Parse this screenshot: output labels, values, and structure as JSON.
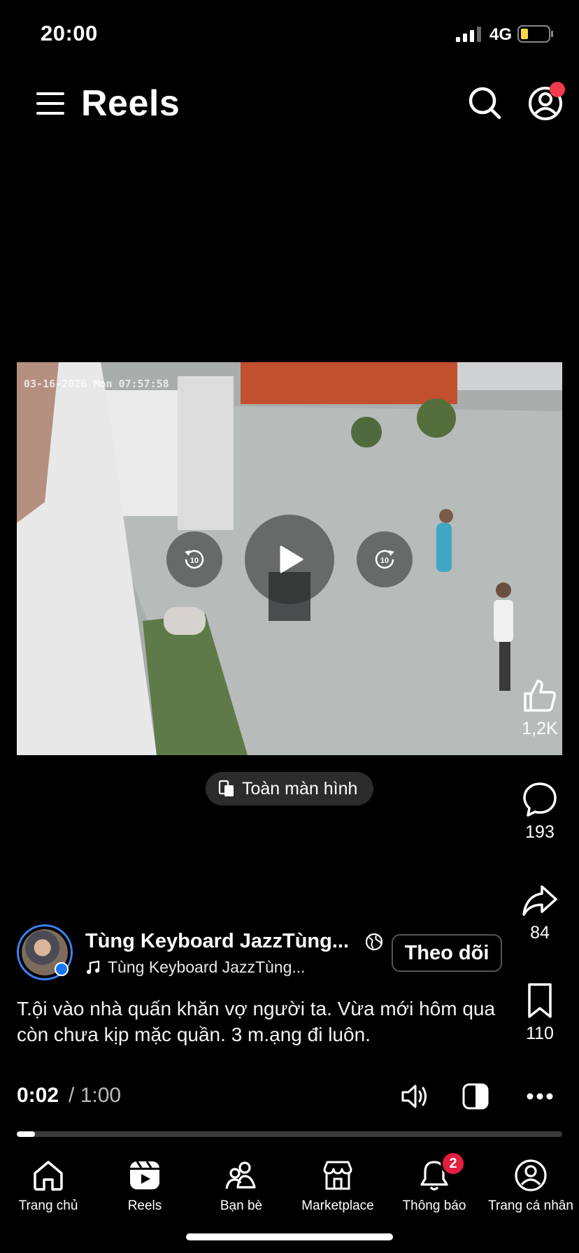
{
  "status_bar": {
    "time": "20:00",
    "network": "4G",
    "battery_color": "#f5d64a"
  },
  "header": {
    "title": "Reels",
    "menu_icon": "hamburger-menu-icon",
    "search_icon": "search-icon",
    "profile_icon": "profile-icon",
    "notification_dot_color": "#f23b4a"
  },
  "video": {
    "timestamp_overlay": "03-16-2026 Mon 07:57:58",
    "controls": {
      "rewind_label": "10",
      "forward_label": "10",
      "play_icon": "play-icon"
    }
  },
  "actions": {
    "like_count": "1,2K",
    "comment_count": "193",
    "share_count": "84",
    "save_count": "110"
  },
  "fullscreen": {
    "label": "Toàn màn hình"
  },
  "author": {
    "name": "Tùng Keyboard JazzTùng...",
    "music": "Tùng Keyboard JazzTùng...",
    "follow_label": "Theo dõi",
    "verified": true
  },
  "caption": "T.ội vào nhà quấn khăn vợ người ta. Vừa mới hôm qua còn chưa kịp mặc quần. 3 m.ạng đi luôn.",
  "playback": {
    "current": "0:02",
    "separator": "/",
    "total": "1:00",
    "progress_fraction": 0.033
  },
  "bottom_nav": [
    {
      "label": "Trang chủ",
      "icon": "home-icon"
    },
    {
      "label": "Reels",
      "icon": "reels-icon",
      "active": true
    },
    {
      "label": "Bạn bè",
      "icon": "friends-icon"
    },
    {
      "label": "Marketplace",
      "icon": "marketplace-icon"
    },
    {
      "label": "Thông báo",
      "icon": "bell-icon",
      "badge": "2"
    },
    {
      "label": "Trang cá nhân",
      "icon": "profile-icon"
    }
  ]
}
